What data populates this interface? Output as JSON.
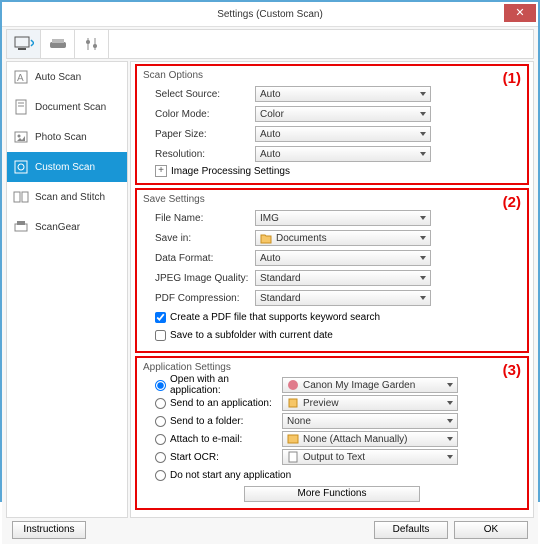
{
  "window": {
    "title": "Settings (Custom Scan)"
  },
  "sidebar": {
    "items": [
      {
        "label": "Auto Scan"
      },
      {
        "label": "Document Scan"
      },
      {
        "label": "Photo Scan"
      },
      {
        "label": "Custom Scan"
      },
      {
        "label": "Scan and Stitch"
      },
      {
        "label": "ScanGear"
      }
    ]
  },
  "sections": {
    "scan": {
      "title": "Scan Options",
      "callout": "(1)",
      "select_source_label": "Select Source:",
      "select_source_value": "Auto",
      "color_mode_label": "Color Mode:",
      "color_mode_value": "Color",
      "paper_size_label": "Paper Size:",
      "paper_size_value": "Auto",
      "resolution_label": "Resolution:",
      "resolution_value": "Auto",
      "image_processing": "Image Processing Settings"
    },
    "save": {
      "title": "Save Settings",
      "callout": "(2)",
      "file_name_label": "File Name:",
      "file_name_value": "IMG",
      "save_in_label": "Save in:",
      "save_in_value": "Documents",
      "data_format_label": "Data Format:",
      "data_format_value": "Auto",
      "jpeg_label": "JPEG Image Quality:",
      "jpeg_value": "Standard",
      "pdf_label": "PDF Compression:",
      "pdf_value": "Standard",
      "chk_keyword": "Create a PDF file that supports keyword search",
      "chk_subfolder": "Save to a subfolder with current date"
    },
    "app": {
      "title": "Application Settings",
      "callout": "(3)",
      "open_app_label": "Open with an application:",
      "open_app_value": "Canon My Image Garden",
      "send_app_label": "Send to an application:",
      "send_app_value": "Preview",
      "send_folder_label": "Send to a folder:",
      "send_folder_value": "None",
      "attach_label": "Attach to e-mail:",
      "attach_value": "None (Attach Manually)",
      "ocr_label": "Start OCR:",
      "ocr_value": "Output to Text",
      "no_start": "Do not start any application",
      "more": "More Functions"
    }
  },
  "footer": {
    "instructions": "Instructions",
    "defaults": "Defaults",
    "ok": "OK"
  }
}
